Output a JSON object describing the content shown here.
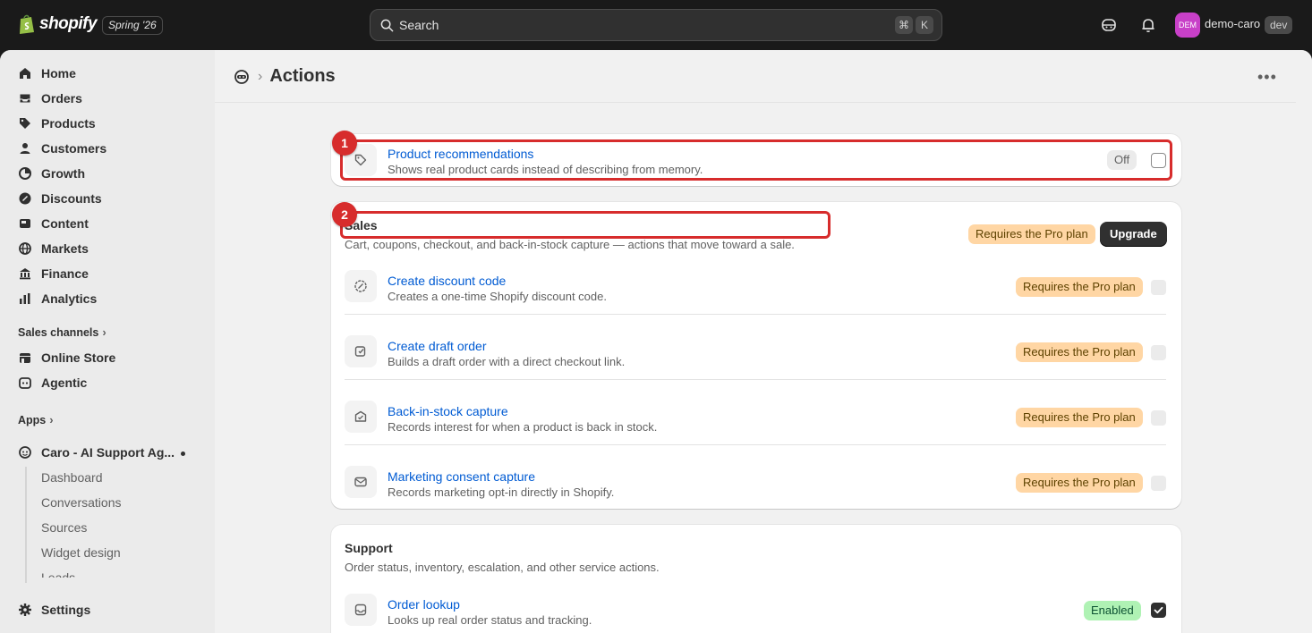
{
  "topbar": {
    "brand": "shopify",
    "edition": "Spring '26",
    "search_placeholder": "Search",
    "shortcut_cmd": "⌘",
    "shortcut_key": "K",
    "avatar_initials": "DEM",
    "store_name": "demo-caro",
    "env_badge": "dev"
  },
  "sidebar": {
    "items": [
      {
        "label": "Home",
        "icon": "home-icon"
      },
      {
        "label": "Orders",
        "icon": "orders-icon"
      },
      {
        "label": "Products",
        "icon": "tag-icon"
      },
      {
        "label": "Customers",
        "icon": "person-icon"
      },
      {
        "label": "Growth",
        "icon": "growth-icon"
      },
      {
        "label": "Discounts",
        "icon": "discount-icon"
      },
      {
        "label": "Content",
        "icon": "content-icon"
      },
      {
        "label": "Markets",
        "icon": "globe-icon"
      },
      {
        "label": "Finance",
        "icon": "bank-icon"
      },
      {
        "label": "Analytics",
        "icon": "chart-icon"
      }
    ],
    "sales_channels_label": "Sales channels",
    "channels": [
      {
        "label": "Online Store",
        "icon": "store-icon"
      },
      {
        "label": "Agentic",
        "icon": "agentic-icon"
      }
    ],
    "apps_label": "Apps",
    "app_name": "Caro - AI Support Ag...",
    "app_subitems": [
      "Dashboard",
      "Conversations",
      "Sources",
      "Widget design",
      "Leads"
    ],
    "settings_label": "Settings"
  },
  "page": {
    "title": "Actions",
    "more_label": "•••"
  },
  "highlights": {
    "one": "1",
    "two": "2"
  },
  "card_top": {
    "title": "Product recommendations",
    "desc": "Shows real product cards instead of describing from memory.",
    "status": "Off"
  },
  "sales": {
    "title": "Sales",
    "desc": "Cart, coupons, checkout, and back-in-stock capture — actions that move toward a sale.",
    "plan_badge": "Requires the Pro plan",
    "upgrade_label": "Upgrade",
    "rows": [
      {
        "title": "Create discount code",
        "desc": "Creates a one-time Shopify discount code.",
        "badge": "Requires the Pro plan"
      },
      {
        "title": "Create draft order",
        "desc": "Builds a draft order with a direct checkout link.",
        "badge": "Requires the Pro plan"
      },
      {
        "title": "Back-in-stock capture",
        "desc": "Records interest for when a product is back in stock.",
        "badge": "Requires the Pro plan"
      },
      {
        "title": "Marketing consent capture",
        "desc": "Records marketing opt-in directly in Shopify.",
        "badge": "Requires the Pro plan"
      }
    ]
  },
  "support": {
    "title": "Support",
    "desc": "Order status, inventory, escalation, and other service actions.",
    "rows": [
      {
        "title": "Order lookup",
        "desc": "Looks up real order status and tracking.",
        "badge": "Enabled"
      }
    ]
  }
}
